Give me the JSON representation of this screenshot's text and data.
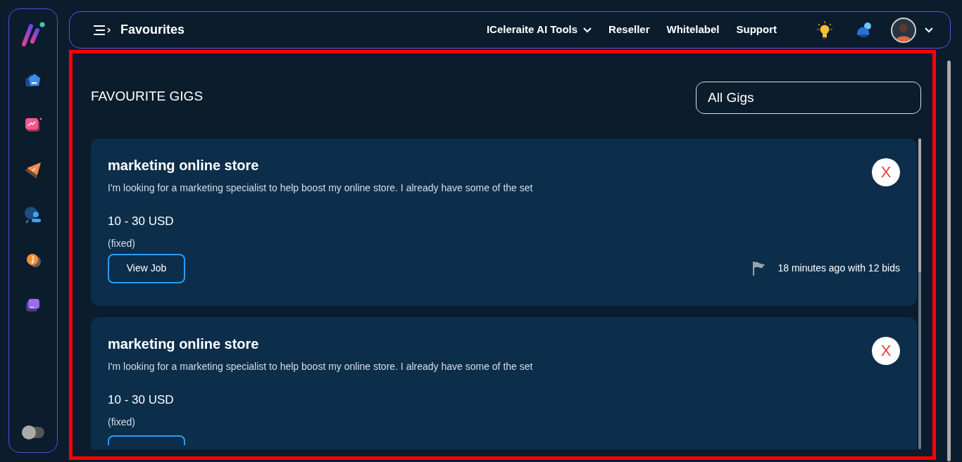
{
  "header": {
    "title": "Favourites",
    "nav": [
      {
        "label": "ICeleraite AI Tools",
        "kind": "dropdown"
      },
      {
        "label": "Reseller",
        "kind": "link"
      },
      {
        "label": "Whitelabel",
        "kind": "link"
      },
      {
        "label": "Support",
        "kind": "link"
      }
    ]
  },
  "sidebar": {
    "theme_toggle": {
      "on": false
    }
  },
  "page": {
    "title": "FAVOURITE GIGS",
    "filter": {
      "value": "All Gigs"
    }
  },
  "gigs": [
    {
      "title": "marketing online store",
      "description": "I'm looking for a marketing specialist to help boost my online store. I already have some of the set",
      "budget": "10 - 30 USD",
      "type": "(fixed)",
      "button": "View Job",
      "meta": "18 minutes ago with 12 bids",
      "remove": "X",
      "clipped": false
    },
    {
      "title": "marketing online store",
      "description": "I'm looking for a marketing specialist to help boost my online store. I already have some of the set",
      "budget": "10 - 30 USD",
      "type": "(fixed)",
      "remove": "X",
      "clipped": true
    }
  ]
}
